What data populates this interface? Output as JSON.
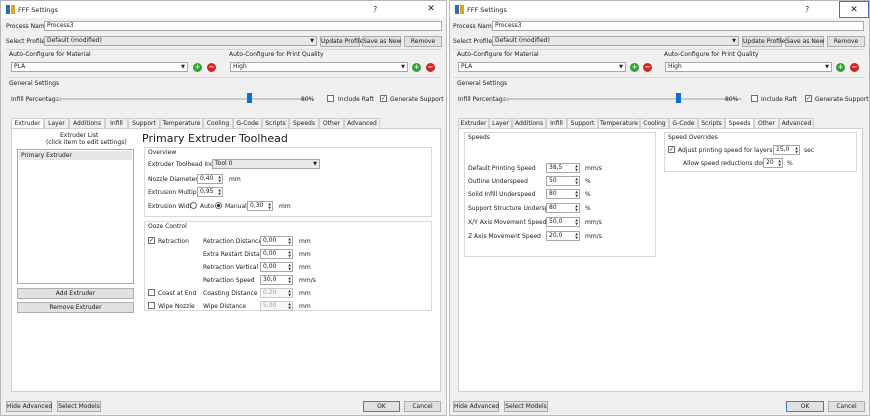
{
  "left": {
    "title": "FFF Settings",
    "help": "?",
    "close": "✕",
    "process_name_label": "Process Name:",
    "process_name_value": "Process3",
    "select_profile_label": "Select Profile:",
    "select_profile_value": "Default (modified)",
    "update_profile": "Update Profile",
    "save_as_new": "Save as New",
    "remove": "Remove",
    "auto_material_label": "Auto-Configure for Material",
    "material_value": "PLA",
    "auto_quality_label": "Auto-Configure for Print Quality",
    "quality_value": "High",
    "general_settings": "General Settings",
    "infill_label": "Infill Percentage:",
    "infill_value": "80%",
    "infill_fraction": 0.8,
    "include_raft": "Include Raft",
    "generate_support": "Generate Support",
    "tabs": [
      "Extruder",
      "Layer",
      "Additions",
      "Infill",
      "Support",
      "Temperature",
      "Cooling",
      "G-Code",
      "Scripts",
      "Speeds",
      "Other",
      "Advanced"
    ],
    "active_tab": "Extruder",
    "extruder_list_title": "Extruder List",
    "extruder_list_hint": "(click item to edit settings)",
    "extruder_items": [
      "Primary Extruder"
    ],
    "add_extruder": "Add Extruder",
    "remove_extruder": "Remove Extruder",
    "toolhead_title": "Primary Extruder Toolhead",
    "overview": {
      "title": "Overview",
      "toolhead_index_label": "Extruder Toolhead Index",
      "toolhead_index_value": "Tool 0",
      "nozzle_label": "Nozzle Diameter",
      "nozzle_value": "0,40",
      "nozzle_unit": "mm",
      "multiplier_label": "Extrusion Multiplier",
      "multiplier_value": "0,95",
      "width_label": "Extrusion Width",
      "auto": "Auto",
      "manual": "Manual",
      "width_value": "0,30",
      "width_unit": "mm"
    },
    "ooze": {
      "title": "Ooze Control",
      "retraction": "Retraction",
      "coast_at_end": "Coast at End",
      "wipe_nozzle": "Wipe Nozzle",
      "rows": [
        {
          "label": "Retraction Distance",
          "value": "0,00",
          "unit": "mm",
          "disabled": false
        },
        {
          "label": "Extra Restart Distance",
          "value": "0,00",
          "unit": "mm",
          "disabled": false
        },
        {
          "label": "Retraction Vertical Lift",
          "value": "0,00",
          "unit": "mm",
          "disabled": false
        },
        {
          "label": "Retraction Speed",
          "value": "30,0",
          "unit": "mm/s",
          "disabled": false
        },
        {
          "label": "Coasting Distance",
          "value": "0,20",
          "unit": "mm",
          "disabled": true
        },
        {
          "label": "Wipe Distance",
          "value": "5,00",
          "unit": "mm",
          "disabled": true
        }
      ]
    },
    "hide_advanced": "Hide Advanced",
    "select_models": "Select Models",
    "ok": "OK",
    "cancel": "Cancel"
  },
  "right": {
    "title": "FFF Settings",
    "help": "?",
    "close": "✕",
    "process_name_label": "Process Name:",
    "process_name_value": "Process3",
    "select_profile_label": "Select Profile:",
    "select_profile_value": "Default (modified)",
    "update_profile": "Update Profile",
    "save_as_new": "Save as New",
    "remove": "Remove",
    "auto_material_label": "Auto-Configure for Material",
    "material_value": "PLA",
    "auto_quality_label": "Auto-Configure for Print Quality",
    "quality_value": "High",
    "general_settings": "General Settings",
    "infill_label": "Infill Percentage:",
    "infill_value": "80%",
    "infill_fraction": 0.8,
    "include_raft": "Include Raft",
    "generate_support": "Generate Support",
    "tabs": [
      "Extruder",
      "Layer",
      "Additions",
      "Infill",
      "Support",
      "Temperature",
      "Cooling",
      "G-Code",
      "Scripts",
      "Speeds",
      "Other",
      "Advanced"
    ],
    "active_tab": "Speeds",
    "speeds": {
      "title": "Speeds",
      "rows": [
        {
          "label": "Default Printing Speed",
          "value": "38,5",
          "unit": "mm/s"
        },
        {
          "label": "Outline Underspeed",
          "value": "50",
          "unit": "%"
        },
        {
          "label": "Solid Infill Underspeed",
          "value": "80",
          "unit": "%"
        },
        {
          "label": "Support Structure Underspeed",
          "value": "80",
          "unit": "%"
        },
        {
          "label": "X/Y Axis Movement Speed",
          "value": "50,0",
          "unit": "mm/s"
        },
        {
          "label": "Z Axis Movement Speed",
          "value": "20,0",
          "unit": "mm/s"
        }
      ]
    },
    "overrides": {
      "title": "Speed Overrides",
      "adjust_label": "Adjust printing speed for layers below",
      "adjust_value": "15,0",
      "adjust_unit": "sec",
      "allow_label": "Allow speed reductions down to",
      "allow_value": "20",
      "allow_unit": "%"
    },
    "hide_advanced": "Hide Advanced",
    "select_models": "Select Models",
    "ok": "OK",
    "cancel": "Cancel"
  },
  "colors": {
    "accent": "#0a6fd6",
    "green": "#2ea52e",
    "red": "#d42424"
  }
}
